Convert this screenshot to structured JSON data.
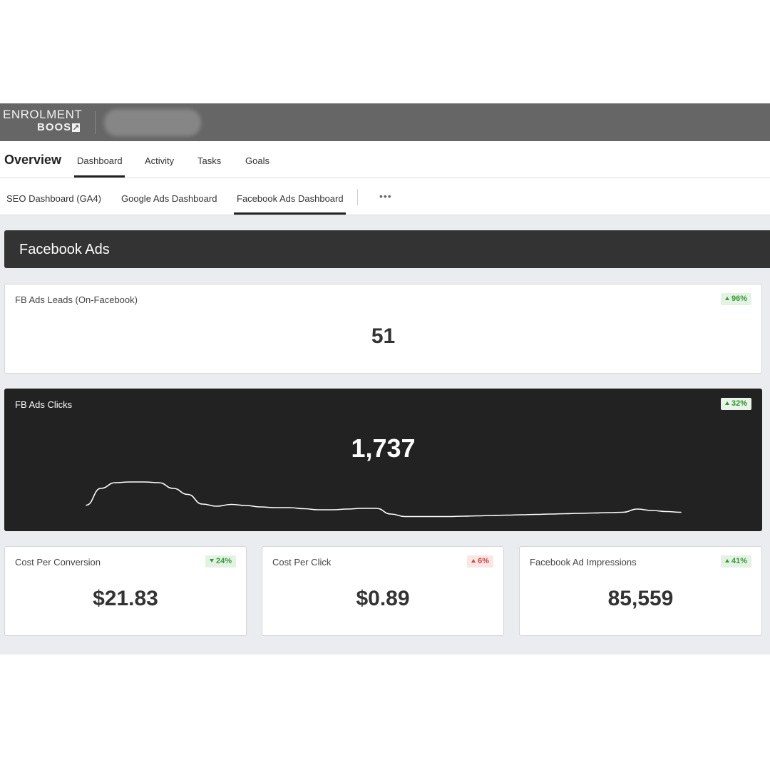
{
  "brand": {
    "logo_line1": "ENROLMENT",
    "logo_line2": "BOOS",
    "logo_icon": "arrow-up-right-icon"
  },
  "nav": {
    "title": "Overview",
    "tabs": [
      {
        "label": "Dashboard",
        "active": true
      },
      {
        "label": "Activity",
        "active": false
      },
      {
        "label": "Tasks",
        "active": false
      },
      {
        "label": "Goals",
        "active": false
      }
    ]
  },
  "subnav": {
    "tabs": [
      {
        "label": "SEO Dashboard (GA4)",
        "active": false
      },
      {
        "label": "Google Ads Dashboard",
        "active": false
      },
      {
        "label": "Facebook Ads Dashboard",
        "active": true
      }
    ],
    "more_label": "•••"
  },
  "section": {
    "title": "Facebook Ads"
  },
  "cards": {
    "leads": {
      "title": "FB Ads Leads (On-Facebook)",
      "value": "51",
      "change": "96%",
      "direction": "up"
    },
    "clicks": {
      "title": "FB Ads Clicks",
      "value": "1,737",
      "change": "32%",
      "direction": "up"
    },
    "cost_per_conversion": {
      "title": "Cost Per Conversion",
      "value": "$21.83",
      "change": "24%",
      "direction": "down"
    },
    "cost_per_click": {
      "title": "Cost Per Click",
      "value": "$0.89",
      "change": "6%",
      "direction": "up"
    },
    "impressions": {
      "title": "Facebook Ad Impressions",
      "value": "85,559",
      "change": "41%",
      "direction": "up"
    }
  },
  "colors": {
    "header_bg": "#666666",
    "section_bg": "#333333",
    "dark_card_bg": "#222222",
    "positive": "#3a9a3a",
    "negative": "#d04545"
  },
  "sparkline": {
    "series": [
      0.15,
      0.62,
      0.78,
      0.8,
      0.8,
      0.78,
      0.62,
      0.45,
      0.18,
      0.12,
      0.17,
      0.14,
      0.1,
      0.08,
      0.08,
      0.05,
      0.02,
      0.02,
      0.04,
      0.06,
      0.06,
      -0.1,
      -0.17,
      -0.17,
      -0.17,
      -0.17,
      -0.16,
      -0.15,
      -0.14,
      -0.13,
      -0.12,
      -0.11,
      -0.1,
      -0.09,
      -0.08,
      -0.07,
      -0.06,
      -0.05,
      0.04,
      0.0,
      -0.03,
      -0.05
    ]
  }
}
